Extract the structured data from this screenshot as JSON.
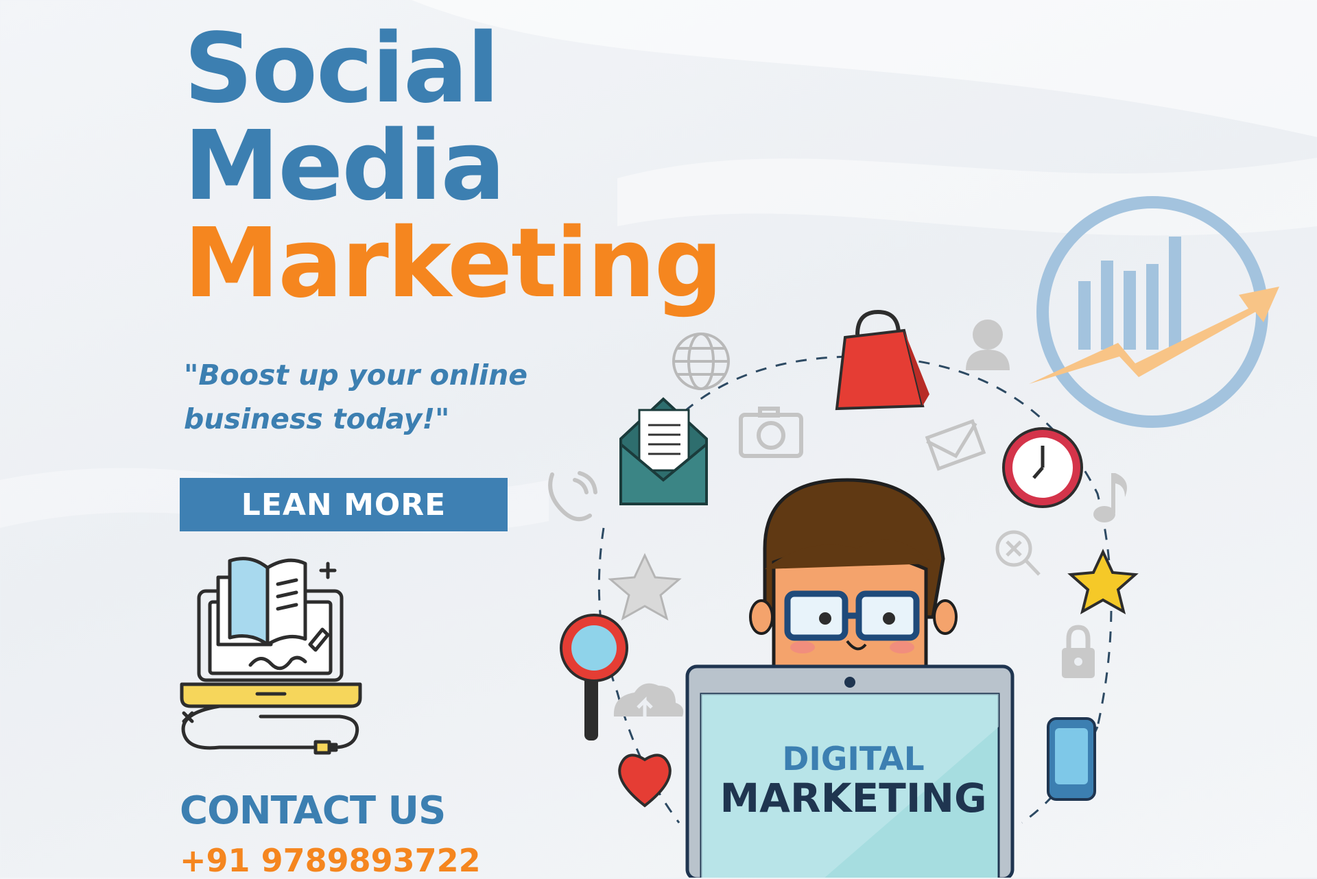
{
  "headline": {
    "line1": "Social",
    "line2": "Media",
    "line3": "Marketing"
  },
  "tagline": "\"Boost up your online business today!\"",
  "cta": {
    "label": "LEAN MORE"
  },
  "contact": {
    "title": "CONTACT US",
    "phone": "+91 9789893722"
  },
  "screen": {
    "line1": "DIGITAL",
    "line2": "MARKETING"
  },
  "colors": {
    "blue": "#3c7fb1",
    "orange": "#f5861f",
    "dark_navy": "#1f3550",
    "button": "#3e80b3"
  },
  "icons": [
    "growth-chart-icon",
    "globe-icon",
    "shopping-bag-icon",
    "user-icon",
    "camera-icon",
    "mail-icon",
    "envelope-open-icon",
    "phone-icon",
    "clock-icon",
    "music-note-icon",
    "search-icon",
    "star-icon",
    "magnifier-icon",
    "cloud-upload-icon",
    "lock-icon",
    "heart-icon",
    "smartphone-icon",
    "laptop-book-icon"
  ]
}
